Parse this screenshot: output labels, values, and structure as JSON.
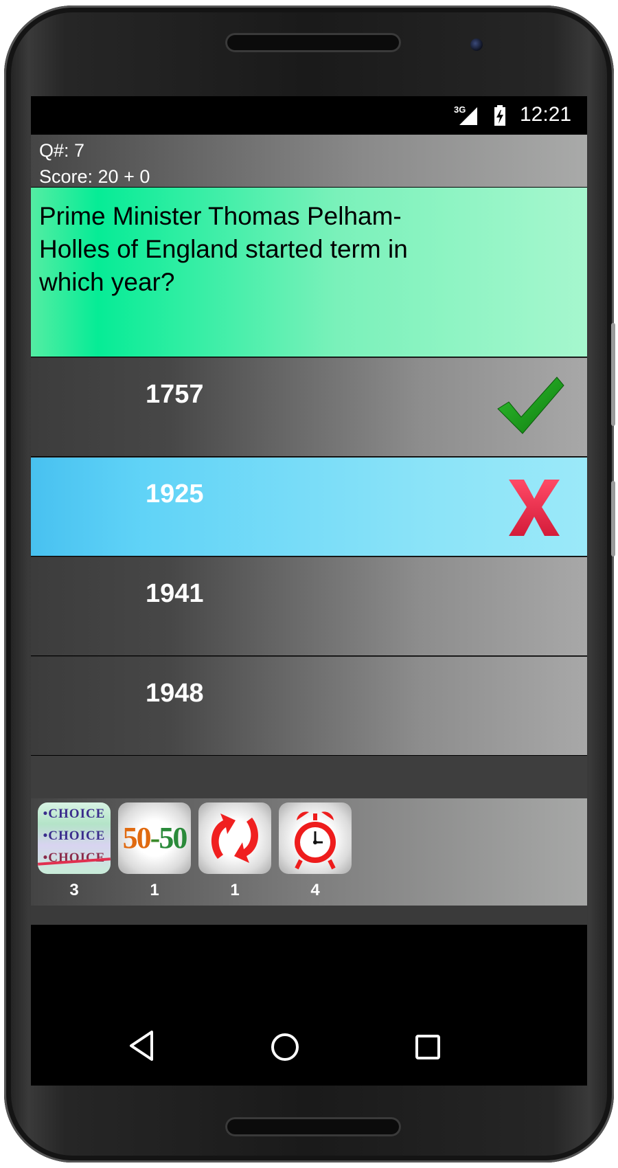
{
  "status_bar": {
    "network": "3G",
    "time": "12:21"
  },
  "header": {
    "question_number": "Q#: 7",
    "score": "Score: 20 + 0"
  },
  "question": {
    "text": "Prime Minister Thomas Pelham-Holles of England started term in which year?"
  },
  "answers": [
    {
      "label": "1757",
      "mark": "check-icon",
      "state": "correct"
    },
    {
      "label": "1925",
      "mark": "x-icon",
      "state": "selected-wrong"
    },
    {
      "label": "1941",
      "mark": "",
      "state": "normal"
    },
    {
      "label": "1948",
      "mark": "",
      "state": "normal"
    }
  ],
  "lifelines": [
    {
      "icon": "choice-icon",
      "count": "3",
      "lines": [
        "•CHOICE",
        "•CHOICE",
        "•CHOICE"
      ]
    },
    {
      "icon": "fifty-fifty-icon",
      "count": "1",
      "text_left": "50",
      "text_mid": "-",
      "text_right": "50"
    },
    {
      "icon": "swap-arrows-icon",
      "count": "1"
    },
    {
      "icon": "alarm-clock-icon",
      "count": "4"
    }
  ],
  "colors": {
    "question_bg": "#06ec96",
    "selected_bg": "#60d3f7",
    "check": "#1c9e1c",
    "cross": "#e83050"
  },
  "nav": [
    "back-icon",
    "home-icon",
    "recents-icon"
  ]
}
